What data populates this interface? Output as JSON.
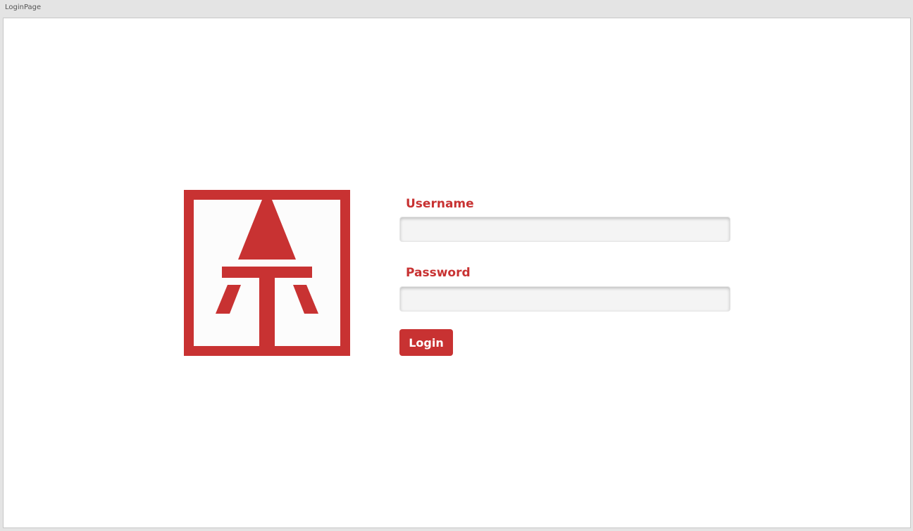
{
  "window": {
    "title": "LoginPage"
  },
  "logo": {
    "name": "at-monogram-logo",
    "colors": {
      "brand": "#c83232",
      "background": "#fcfcfc"
    }
  },
  "form": {
    "username": {
      "label": "Username",
      "value": "",
      "placeholder": ""
    },
    "password": {
      "label": "Password",
      "value": "",
      "placeholder": ""
    },
    "login_button_label": "Login"
  },
  "colors": {
    "accent": "#c83232",
    "field_background": "#f4f4f4",
    "window_chrome": "#e4e4e4"
  }
}
